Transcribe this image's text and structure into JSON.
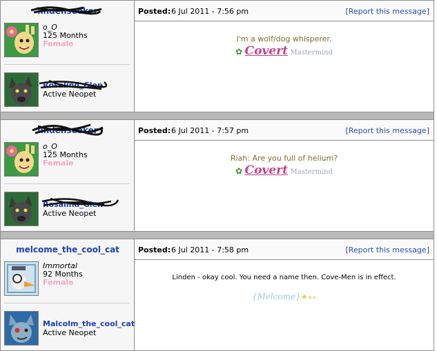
{
  "posts": [
    {
      "username": "lindenseeker",
      "user_title": "o_O",
      "user_age": "125 Months",
      "user_gender": "Female",
      "pet_name": "Rosalind_Glen",
      "pet_status": "Active Neopet",
      "posted_label": "Posted:",
      "posted_date": "6 Jul 2011 - 7:56 pm",
      "report_label": "Report this message",
      "message": "I'm a wolf/dog whisperer.",
      "signature": {
        "name": "Covert",
        "rank": "Mastermind"
      }
    },
    {
      "username": "lindenseeker",
      "user_title": "o_O",
      "user_age": "125 Months",
      "user_gender": "Female",
      "pet_name": "Rosalind_Glen",
      "pet_status": "Active Neopet",
      "posted_label": "Posted:",
      "posted_date": "6 Jul 2011 - 7:57 pm",
      "report_label": "Report this message",
      "message": "Riah: Are you full of helium?",
      "signature": {
        "name": "Covert",
        "rank": "Mastermind"
      }
    },
    {
      "username": "melcome_the_cool_cat",
      "user_title": "Immortal",
      "user_age": "92 Months",
      "user_gender": "Female",
      "pet_name": "Malcolm_the_cool_cat",
      "pet_status": "Active Neopet",
      "posted_label": "Posted:",
      "posted_date": "6 Jul 2011 - 7:58 pm",
      "report_label": "Report this message",
      "message": "Linden - okay cool. You need a name then. Cove-Men is in effect.",
      "signature": {
        "name": "{Melcome}"
      }
    }
  ],
  "brackets": {
    "open": "[",
    "close": "]"
  },
  "icons": {
    "signature_flower": "flower-icon",
    "stars": "star-icon"
  },
  "colors": {
    "link_blue": "#1d3fb4",
    "gender_pink": "#f7a7c4",
    "signature_pink": "#c7408a",
    "separator_gray": "#b9b9b9"
  }
}
